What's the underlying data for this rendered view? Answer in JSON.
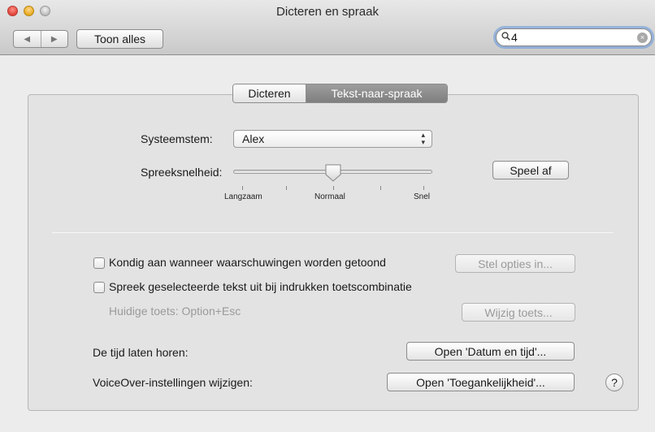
{
  "window": {
    "title": "Dicteren en spraak"
  },
  "toolbar": {
    "back_glyph": "◀",
    "forward_glyph": "▶",
    "show_all_label": "Toon alles",
    "search_value": "4",
    "search_clear_glyph": "×"
  },
  "tabs": [
    {
      "label": "Dicteren",
      "selected": false
    },
    {
      "label": "Tekst-naar-spraak",
      "selected": true
    }
  ],
  "voice": {
    "label": "Systeemstem:",
    "selected": "Alex"
  },
  "rate": {
    "label": "Spreeksnelheid:",
    "level": 0.5,
    "tick_labels": [
      "Langzaam",
      "Normaal",
      "Snel"
    ],
    "play_button": "Speel af"
  },
  "options": {
    "announce": {
      "label": "Kondig aan wanneer waarschuwingen worden getoond",
      "checked": false,
      "button": "Stel opties in..."
    },
    "speak_selected": {
      "label": "Spreek geselecteerde tekst uit bij indrukken toetscombinatie",
      "checked": false,
      "current_key": "Huidige toets: Option+Esc",
      "button": "Wijzig toets..."
    }
  },
  "time": {
    "label": "De tijd laten horen:",
    "button": "Open 'Datum en tijd'..."
  },
  "voiceover": {
    "label": "VoiceOver-instellingen wijzigen:",
    "button": "Open 'Toegankelijkheid'..."
  },
  "help": {
    "glyph": "?"
  },
  "colors": {
    "selected_tab": "#8a8a8a",
    "search_focus": "#6096dc"
  }
}
